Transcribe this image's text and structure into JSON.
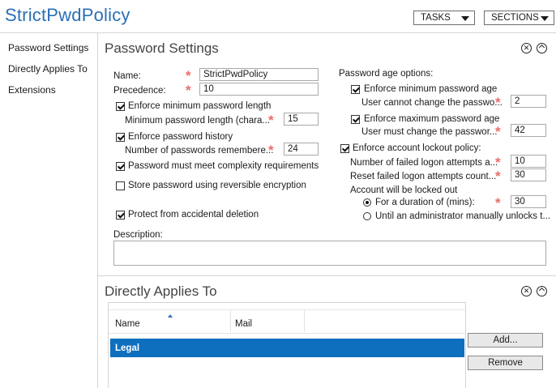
{
  "header": {
    "title": "StrictPwdPolicy",
    "tasks_label": "TASKS",
    "sections_label": "SECTIONS"
  },
  "nav": {
    "items": [
      "Password Settings",
      "Directly Applies To",
      "Extensions"
    ]
  },
  "password_settings": {
    "title": "Password Settings",
    "name_label": "Name:",
    "name_value": "StrictPwdPolicy",
    "precedence_label": "Precedence:",
    "precedence_value": "10",
    "enforce_min_length_label": "Enforce minimum password length",
    "min_length_label": "Minimum password length (chara...",
    "min_length_value": "15",
    "enforce_history_label": "Enforce password history",
    "history_label": "Number of passwords remembere...",
    "history_value": "24",
    "complexity_label": "Password must meet complexity requirements",
    "reversible_label": "Store password using reversible encryption",
    "protect_label": "Protect from accidental deletion",
    "description_label": "Description:",
    "age_options_label": "Password age options:",
    "enforce_min_age_label": "Enforce minimum password age",
    "min_age_label": "User cannot change the passwo...",
    "min_age_value": "2",
    "enforce_max_age_label": "Enforce maximum password age",
    "max_age_label": "User must change the passwor...",
    "max_age_value": "42",
    "lockout_policy_label": "Enforce account lockout policy:",
    "failed_attempts_label": "Number of failed logon attempts a...",
    "failed_attempts_value": "10",
    "reset_attempts_label": "Reset failed logon attempts count...",
    "reset_attempts_value": "30",
    "locked_out_label": "Account will be locked out",
    "duration_label": "For a duration of (mins):",
    "duration_value": "30",
    "admin_unlock_label": "Until an administrator manually unlocks t..."
  },
  "directly_applies_to": {
    "title": "Directly Applies To",
    "columns": [
      "Name",
      "Mail"
    ],
    "rows": [
      {
        "name": "Legal",
        "mail": ""
      }
    ],
    "add_label": "Add...",
    "remove_label": "Remove"
  },
  "colors": {
    "title_blue": "#2b6fb5",
    "selection_blue": "#0e6fbe",
    "required_star": "#e96c6c"
  }
}
